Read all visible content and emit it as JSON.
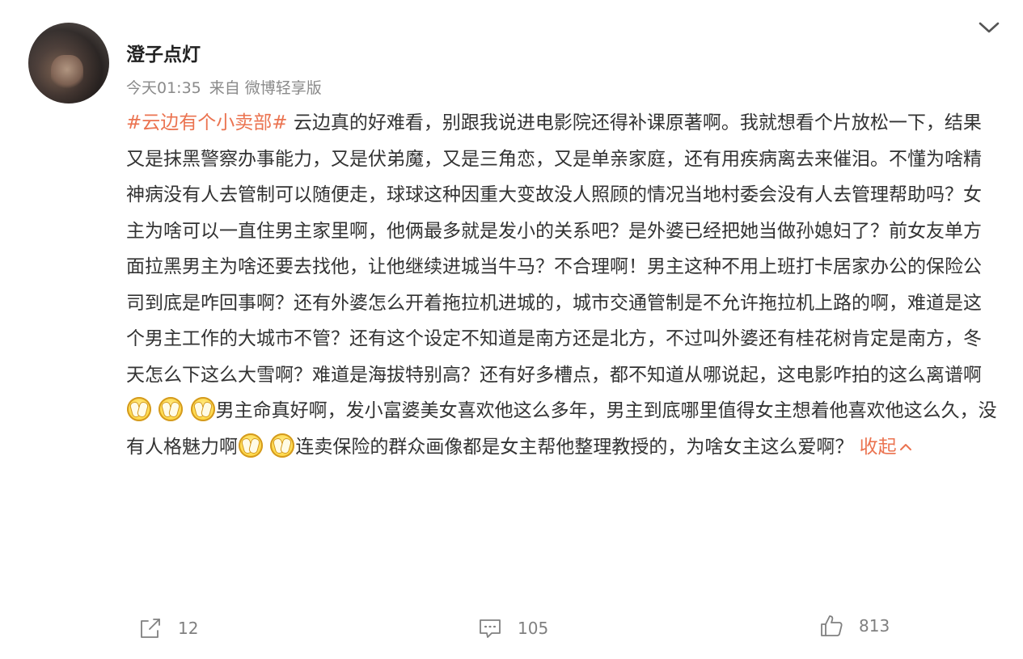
{
  "user": {
    "name": "澄子点灯"
  },
  "post": {
    "time": "今天01:35",
    "source": "来自 微博轻享版",
    "hashtag": "#云边有个小卖部#",
    "text_part1": " 云边真的好难看，别跟我说进电影院还得补课原著啊。我就想看个片放松一下，结果又是抹黑警察办事能力，又是伏弟魔，又是三角恋，又是单亲家庭，还有用疾病离去来催泪。不懂为啥精神病没有人去管制可以随便走，球球这种因重大变故没人照顾的情况当地村委会没有人去管理帮助吗？女主为啥可以一直住男主家里啊，他俩最多就是发小的关系吧？是外婆已经把她当做孙媳妇了？前女友单方面拉黑男主为啥还要去找他，让他继续进城当牛马？不合理啊！男主这种不用上班打卡居家办公的保险公司到底是咋回事啊？还有外婆怎么开着拖拉机进城的，城市交通管制是不允许拖拉机上路的啊，难道是这个男主工作的大城市不管？还有这个设定不知道是南方还是北方，不过叫外婆还有桂花树肯定是南方，冬天怎么下这么大雪啊？难道是海拔特别高？还有好多槽点，都不知道从哪说起，这电影咋拍的这么离谱啊",
    "text_part2": "男主命真好啊，发小富婆美女喜欢他这么多年，男主到底哪里值得女主想着他喜欢他这么久，没有人格魅力啊",
    "text_part3": "连卖保险的群众画像都是女主帮他整理教授的，为啥女主这么爱啊？",
    "collapse_label": "收起",
    "emoji_name": "cry-laugh-emoji"
  },
  "actions": {
    "repost_count": "12",
    "comment_count": "105",
    "like_count": "813"
  },
  "colors": {
    "accent": "#eb7350",
    "meta": "#8a8a8a",
    "text": "#333333"
  }
}
